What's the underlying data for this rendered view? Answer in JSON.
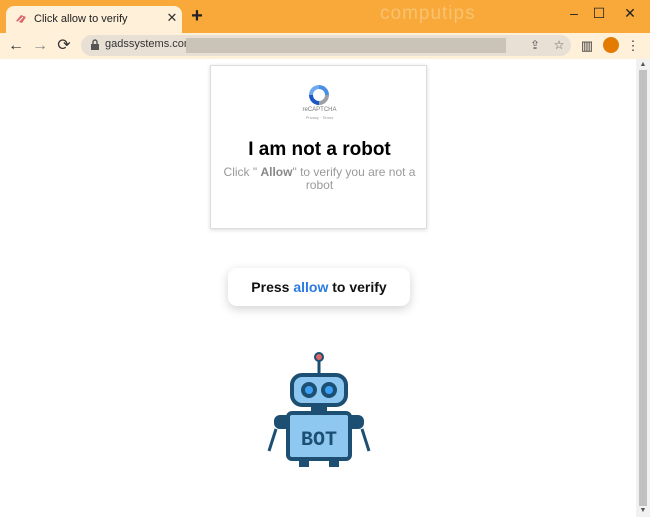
{
  "tab": {
    "title": "Click allow to verify",
    "close": "✕"
  },
  "new_tab": "+",
  "watermark": "computips",
  "window": {
    "minimize": "–",
    "maximize": "☐",
    "close": "✕"
  },
  "toolbar": {
    "back": "←",
    "forward": "→",
    "reload": "⟳",
    "url": "gadssystems.com/",
    "share": "⇪",
    "bookmark": "☆",
    "sidebar": "▥",
    "menu": "⋮"
  },
  "captcha": {
    "logo_label": "reCAPTCHA",
    "links": "Privacy · Terms",
    "title": "I am not a robot",
    "sub_pre": "Click \" ",
    "sub_allow": "Allow",
    "sub_post": "\" to verify you are not a robot"
  },
  "press_button": {
    "pre": "Press ",
    "allow": "allow",
    "post": " to verify"
  },
  "robot": {
    "label": "BOT"
  },
  "colors": {
    "chrome_accent": "#f8a93a",
    "link_blue": "#2a7ae2",
    "robot_dark": "#1d4f72",
    "robot_light": "#8ec8f0"
  }
}
